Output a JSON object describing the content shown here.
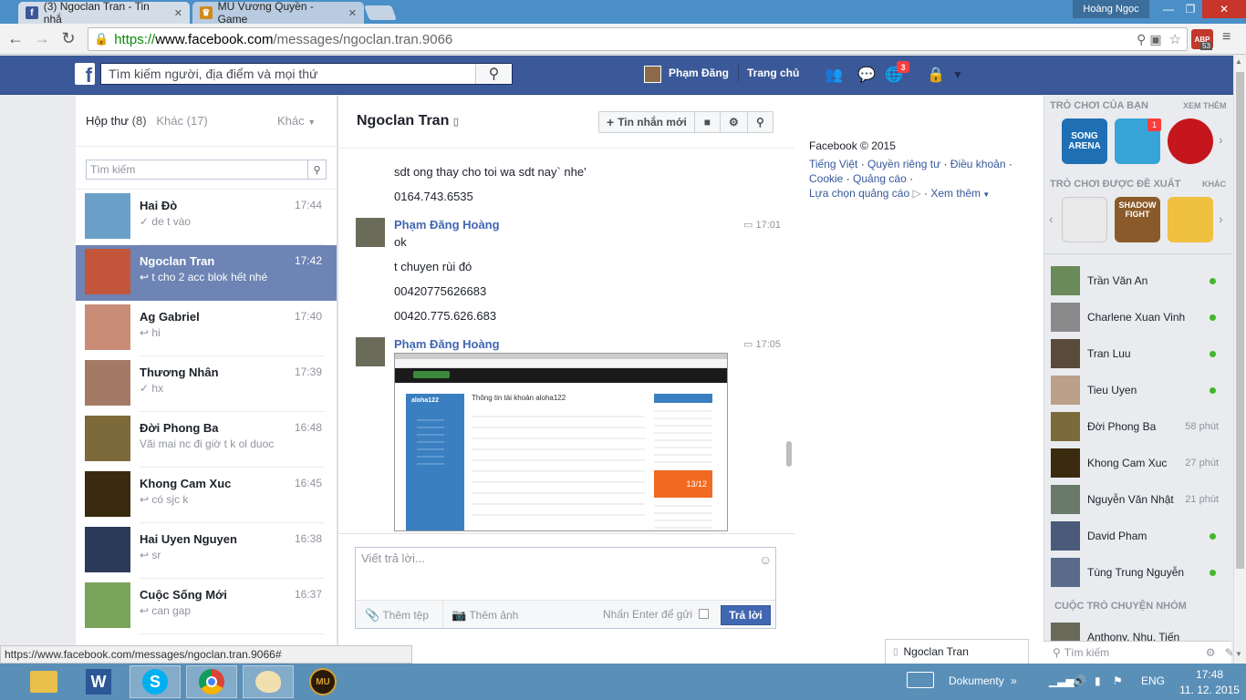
{
  "browser": {
    "tabs": [
      {
        "title": "(3) Ngoclan Tran - Tin nhắ",
        "active": true
      },
      {
        "title": "MU Vương Quyền - Game",
        "active": false
      }
    ],
    "window_user": "Hoàng Ngọc",
    "url_scheme": "https://",
    "url_host": "www.facebook.com",
    "url_path": "/messages/ngoclan.tran.9066",
    "abp_badge": "53",
    "status_url": "https://www.facebook.com/messages/ngoclan.tran.9066#"
  },
  "fb_header": {
    "logo": "f",
    "search_placeholder": "Tìm kiếm người, địa điểm và mọi thứ",
    "profile_name": "Phạm Đăng",
    "home_label": "Trang chủ",
    "notif_count": "3"
  },
  "inbox": {
    "tab_inbox": "Hộp thư",
    "tab_inbox_count": "(8)",
    "tab_other": "Khác",
    "tab_other_count": "(17)",
    "more_label": "Khác",
    "search_placeholder": "Tìm kiếm",
    "conversations": [
      {
        "name": "Hai Đò",
        "time": "17:44",
        "snippet": "✓ de t vào",
        "color": "#6aa0c8"
      },
      {
        "name": "Ngoclan Tran",
        "time": "17:42",
        "snippet": "↩ t cho 2 acc blok hết nhé",
        "color": "#c2553a",
        "selected": true
      },
      {
        "name": "Ag Gabriel",
        "time": "17:40",
        "snippet": "↩ hi",
        "color": "#c98d77"
      },
      {
        "name": "Thương Nhân",
        "time": "17:39",
        "snippet": "✓ hx",
        "color": "#a47a64"
      },
      {
        "name": "Đời Phong Ba",
        "time": "16:48",
        "snippet": "Vãi mai nc đi giờ t k ol duoc",
        "color": "#7c6a3a"
      },
      {
        "name": "Khong Cam Xuc",
        "time": "16:45",
        "snippet": "↩ có sjc k",
        "color": "#3a2a10"
      },
      {
        "name": "Hai Uyen Nguyen",
        "time": "16:38",
        "snippet": "↩ sr",
        "color": "#2c3a5a"
      },
      {
        "name": "Cuộc Sống Mới",
        "time": "16:37",
        "snippet": "↩ can gap",
        "color": "#7aa35a"
      }
    ]
  },
  "chat": {
    "title": "Ngoclan Tran",
    "new_message": "Tin nhắn mới",
    "messages_top": [
      {
        "text": "sdt ong thay cho toi wa sdt nay` nhe'"
      },
      {
        "text": "0164.743.6535"
      }
    ],
    "group1": {
      "sender": "Phạm Đăng Hoàng",
      "time": "17:01",
      "lines": [
        "ok",
        "t chuyen rùi đó",
        "00420775626683",
        "00420.775.626.683"
      ]
    },
    "group2": {
      "sender": "Phạm Đăng Hoàng",
      "time": "17:05",
      "screenshot": {
        "heading": "Thông tin tài khoản aloha122",
        "account": "aloha122",
        "badge": "13/12"
      }
    },
    "reply_placeholder": "Viết trả lời...",
    "add_file": "Thêm tệp",
    "add_photo": "Thêm ảnh",
    "enter_to_send": "Nhấn Enter để gửi",
    "send_label": "Trả lời"
  },
  "right_info": {
    "copyright": "Facebook © 2015",
    "links_line1": [
      "Tiếng Việt",
      "Quyền riêng tư",
      "Điều khoản"
    ],
    "links_line2": [
      "Cookie",
      "Quảng cáo"
    ],
    "ad_choices": "Lựa chọn quảng cáo",
    "see_more": "Xem thêm"
  },
  "sidebar": {
    "your_games": "TRÒ CHƠI CỦA BẠN",
    "see_all": "XEM THÊM",
    "game_badge": "1",
    "suggested_games": "TRÒ CHƠI ĐƯỢC ĐỀ XUẤT",
    "other": "KHÁC",
    "game1_label": "SONG ARENA",
    "game_shadow_label": "SHADOW FIGHT",
    "contacts": [
      {
        "name": "Trần Văn An",
        "status": "online",
        "color": "#6a8a5a"
      },
      {
        "name": "Charlene Xuan Vinh",
        "status": "online",
        "color": "#8a8a8a"
      },
      {
        "name": "Tran Luu",
        "status": "online",
        "color": "#5a4a3a"
      },
      {
        "name": "Tieu Uyen",
        "status": "online",
        "color": "#bba08a"
      },
      {
        "name": "Đời Phong Ba",
        "status": "58 phút",
        "color": "#7c6a3a"
      },
      {
        "name": "Khong Cam Xuc",
        "status": "27 phút",
        "color": "#3a2a10"
      },
      {
        "name": "Nguyễn Văn Nhật",
        "status": "21 phút",
        "color": "#6a7a6a"
      },
      {
        "name": "David Pham",
        "status": "online",
        "color": "#4a5a7a"
      },
      {
        "name": "Tùng Trung Nguyễn",
        "status": "online",
        "color": "#5a6a8a"
      }
    ],
    "group_chats": "CUỘC TRÒ CHUYỆN NHÓM",
    "group_partial": "Anthony, Nhu, Tiến",
    "search_placeholder": "Tìm kiếm"
  },
  "chat_tab": {
    "name": "Ngoclan Tran"
  },
  "taskbar": {
    "tray_label": "Dokumenty",
    "lang": "ENG",
    "time": "17:48",
    "date": "11. 12. 2015"
  }
}
